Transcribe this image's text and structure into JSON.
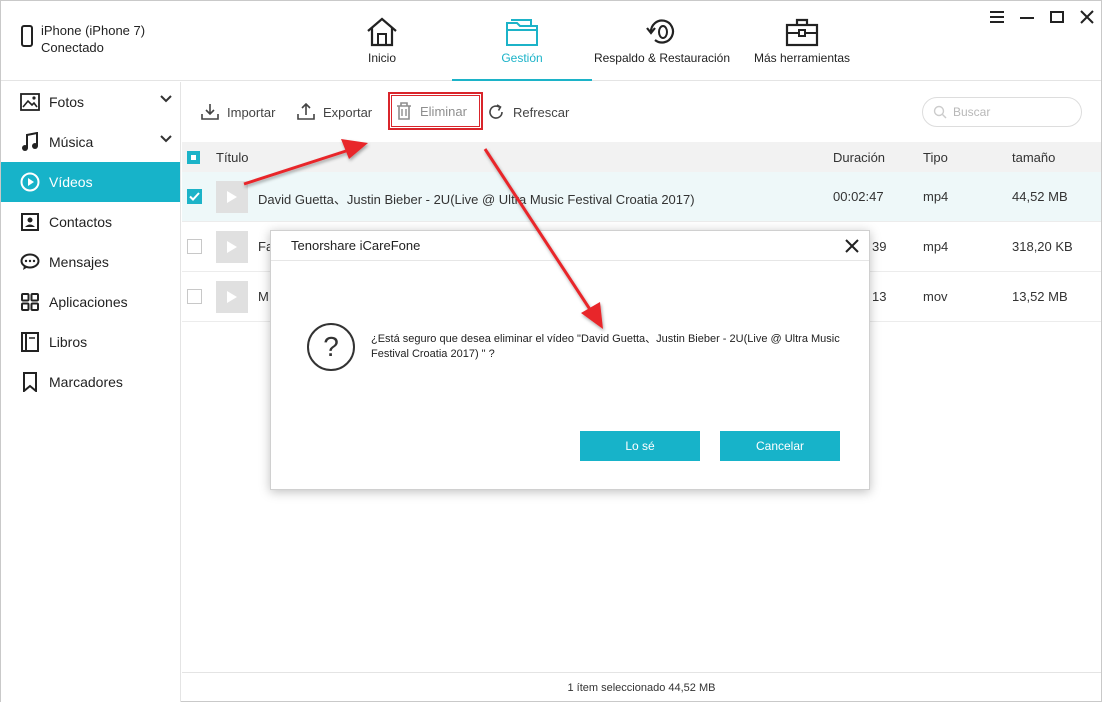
{
  "device": {
    "name": "iPhone (iPhone 7)",
    "status": "Conectado"
  },
  "nav": {
    "tabs": [
      {
        "label": "Inicio",
        "icon": "home-icon"
      },
      {
        "label": "Gestión",
        "icon": "folder-icon",
        "active": true
      },
      {
        "label": "Respaldo & Restauración",
        "icon": "backup-restore-icon"
      },
      {
        "label": "Más herramientas",
        "icon": "toolbox-icon"
      }
    ]
  },
  "sidebar": {
    "items": [
      {
        "label": "Fotos",
        "icon": "photos-icon",
        "expandable": true
      },
      {
        "label": "Música",
        "icon": "music-icon",
        "expandable": true
      },
      {
        "label": "Vídeos",
        "icon": "video-icon",
        "active": true
      },
      {
        "label": "Contactos",
        "icon": "contacts-icon"
      },
      {
        "label": "Mensajes",
        "icon": "messages-icon"
      },
      {
        "label": "Aplicaciones",
        "icon": "apps-icon"
      },
      {
        "label": "Libros",
        "icon": "books-icon"
      },
      {
        "label": "Marcadores",
        "icon": "bookmark-icon"
      }
    ]
  },
  "toolbar": {
    "importar": "Importar",
    "exportar": "Exportar",
    "eliminar": "Eliminar",
    "refrescar": "Refrescar",
    "search_placeholder": "Buscar"
  },
  "table": {
    "columns": {
      "titulo": "Título",
      "duracion": "Duración",
      "tipo": "Tipo",
      "tamano": "tamaño"
    },
    "rows": [
      {
        "title": "David Guetta、Justin Bieber - 2U(Live @ Ultra Music Festival Croatia 2017)",
        "duration": "00:02:47",
        "type": "mp4",
        "size": "44,52 MB",
        "checked": true
      },
      {
        "title": "Fa",
        "duration": "39",
        "type": "mp4",
        "size": "318,20 KB",
        "checked": false
      },
      {
        "title": "M",
        "duration": "13",
        "type": "mov",
        "size": "13,52 MB",
        "checked": false
      }
    ]
  },
  "status": {
    "text": "1 ítem seleccionado 44,52 MB"
  },
  "dialog": {
    "title": "Tenorshare iCareFone",
    "message": "¿Está seguro que desea eliminar el vídeo \"David Guetta、Justin Bieber - 2U(Live @ Ultra Music Festival Croatia 2017) \" ?",
    "confirm": "Lo sé",
    "cancel": "Cancelar"
  },
  "colors": {
    "accent": "#17b3c9",
    "highlight": "#d9252b"
  }
}
